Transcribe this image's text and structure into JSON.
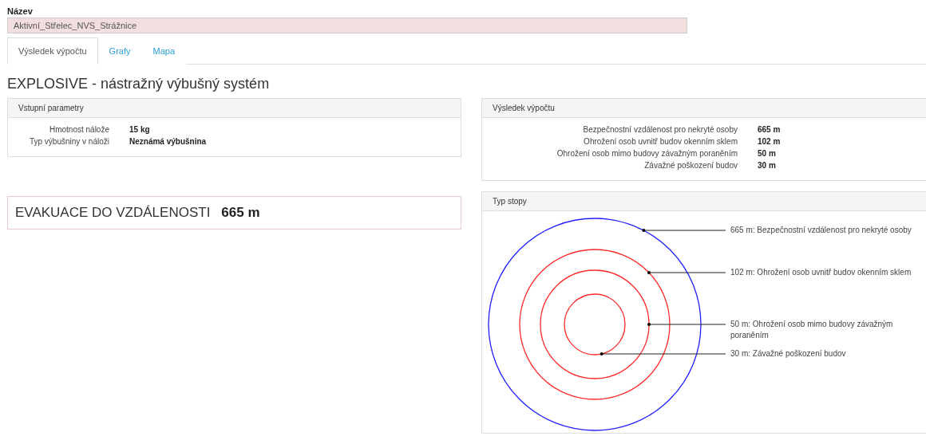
{
  "name_field": {
    "label": "Název",
    "value": "Aktivní_Střelec_NVS_Strážnice"
  },
  "tabs": [
    {
      "label": "Výsledek výpočtu",
      "selected": true
    },
    {
      "label": "Grafy",
      "selected": false
    },
    {
      "label": "Mapa",
      "selected": false
    }
  ],
  "heading": "EXPLOSIVE - nástražný výbušný systém",
  "input_panel": {
    "title": "Vstupní parametry",
    "rows": [
      {
        "label": "Hmotnost nálože",
        "value": "15 kg"
      },
      {
        "label": "Typ výbušniny v náloži",
        "value": "Neznámá výbušnina"
      }
    ]
  },
  "evacuation": {
    "label": "EVAKUACE DO VZDÁLENOSTI",
    "value": "665 m"
  },
  "result_panel": {
    "title": "Výsledek výpočtu",
    "rows": [
      {
        "label": "Bezpečnostní vzdálenost pro nekryté osoby",
        "value": "665 m"
      },
      {
        "label": "Ohrožení osob uvnitř budov okenním sklem",
        "value": "102 m"
      },
      {
        "label": "Ohrožení osob mimo budovy závažným poraněním",
        "value": "50 m"
      },
      {
        "label": "Závažné poškození budov",
        "value": "30 m"
      }
    ]
  },
  "footprint_panel": {
    "title": "Typ stopy",
    "rings": [
      {
        "label": "665 m: Bezpečnostní vzdálenost pro nekryté osoby",
        "color": "#2020ff"
      },
      {
        "label": "102 m: Ohrožení osob uvnitř budov okenním sklem",
        "color": "#ff2a2a"
      },
      {
        "label": "50 m: Ohrožení osob mimo budovy závažným poraněním",
        "color": "#ff2a2a"
      },
      {
        "label": "30 m: Závažné poškození budov",
        "color": "#ff2a2a"
      }
    ]
  }
}
